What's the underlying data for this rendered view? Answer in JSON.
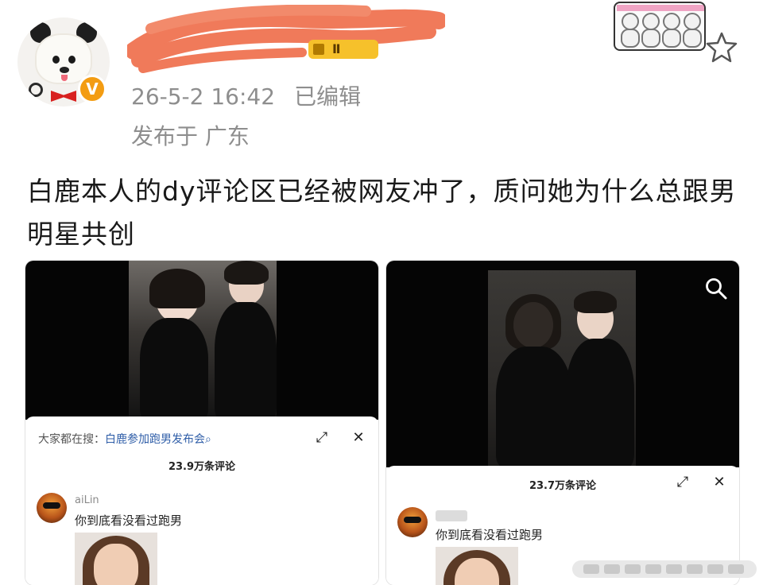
{
  "post": {
    "time": "26-5-2 16:42",
    "edited": "已编辑",
    "location": "发布于 广东",
    "level_badge": "Ⅱ",
    "text": "白鹿本人的dy评论区已经被网友冲了，质问她为什么总跟男明星共创"
  },
  "screenshot_left": {
    "search_prefix": "大家都在搜：",
    "search_keyword": "白鹿参加跑男发布会",
    "comment_count": "23.9万条评论",
    "comment_user": "aiLin",
    "comment_text": "你到底看没看过跑男"
  },
  "screenshot_right": {
    "comment_count": "23.7万条评论",
    "comment_text": "你到底看没看过跑男"
  },
  "icons": {
    "favorite": "star-outline-icon",
    "verified": "v-badge-icon",
    "search": "magnifier-icon",
    "fullscreen": "expand-icon",
    "close": "close-icon"
  },
  "colors": {
    "meta_gray": "#8e8e8e",
    "verified_orange": "#f39c12",
    "scribble_red": "#f07a5a",
    "search_keyword_blue": "#2f5ea8"
  }
}
